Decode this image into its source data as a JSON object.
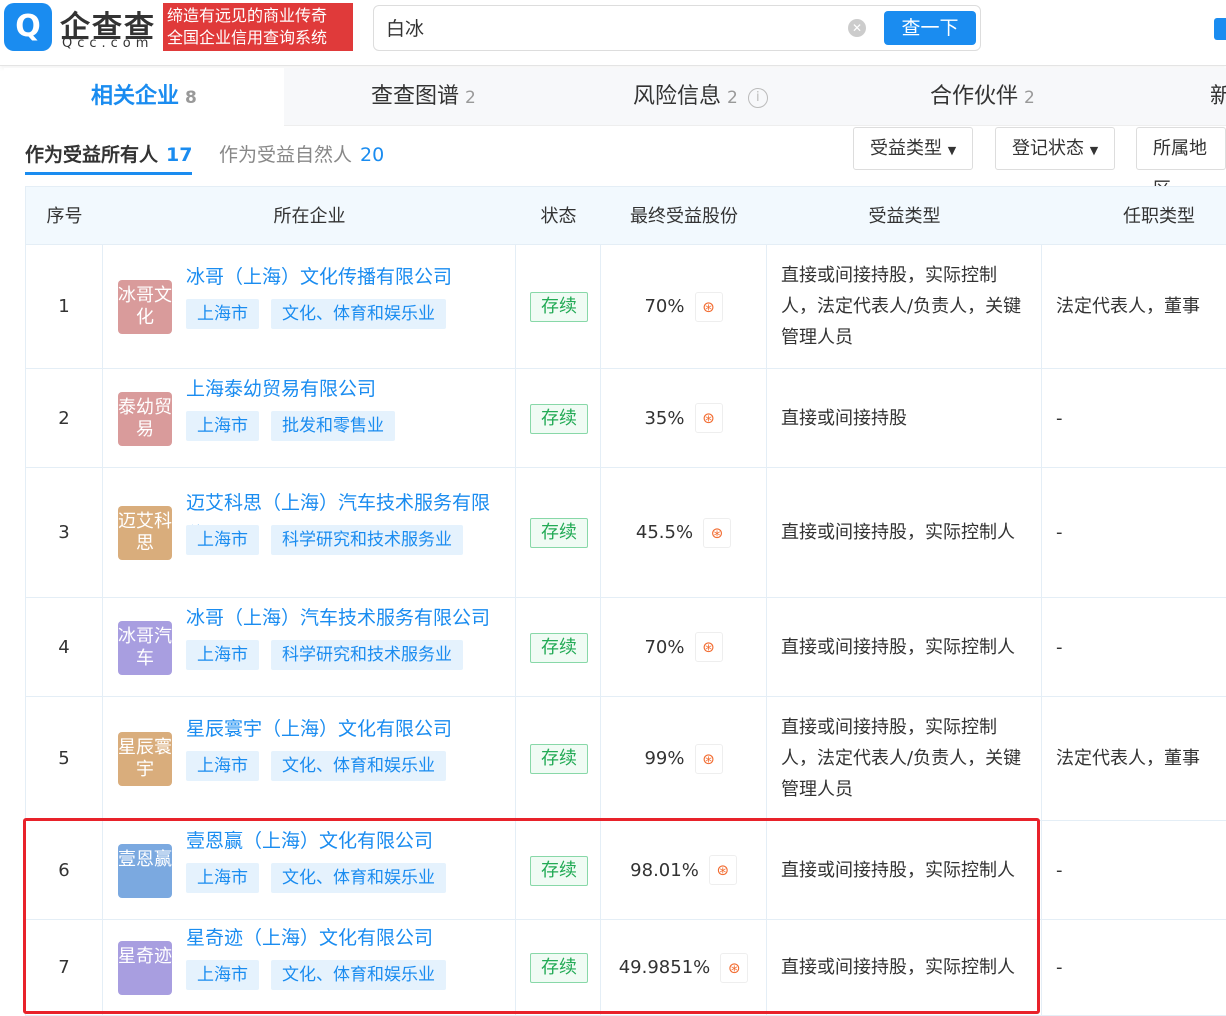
{
  "header": {
    "logo_mark": "Q",
    "logo_text": "企查查",
    "logo_sub": "Qcc.com",
    "slogan_1": "缔造有远见的商业传奇",
    "slogan_2": "全国企业信用查询系统",
    "search_value": "白冰",
    "search_button": "查一下"
  },
  "tabs": [
    {
      "label": "相关企业",
      "count": "8"
    },
    {
      "label": "查查图谱",
      "count": "2"
    },
    {
      "label": "风险信息",
      "count": "2"
    },
    {
      "label": "合作伙伴",
      "count": "2"
    },
    {
      "label": "新"
    }
  ],
  "subtabs": [
    {
      "label": "作为受益所有人",
      "count": "17"
    },
    {
      "label": "作为受益自然人",
      "count": "20"
    }
  ],
  "filters": [
    "受益类型",
    "登记状态",
    "所属地区"
  ],
  "table": {
    "headers": [
      "序号",
      "所在企业",
      "状态",
      "最终受益股份",
      "受益类型",
      "任职类型"
    ],
    "rows": [
      {
        "index": "1",
        "logo": "冰哥文化",
        "logo_color": "#d99b9b",
        "company": "冰哥（上海）文化传播有限公司",
        "tags": [
          "上海市",
          "文化、体育和娱乐业"
        ],
        "status": "存续",
        "share": "70%",
        "benefit": "直接或间接持股，实际控制人，法定代表人/负责人，关键管理人员",
        "role": "法定代表人，董事"
      },
      {
        "index": "2",
        "logo": "泰幼贸易",
        "logo_color": "#d99b9b",
        "company": "上海泰幼贸易有限公司",
        "tags": [
          "上海市",
          "批发和零售业"
        ],
        "status": "存续",
        "share": "35%",
        "benefit": "直接或间接持股",
        "role": "-"
      },
      {
        "index": "3",
        "logo": "迈艾科思",
        "logo_color": "#d9ad7c",
        "company": "迈艾科思（上海）汽车技术服务有限公司",
        "tags": [
          "上海市",
          "科学研究和技术服务业"
        ],
        "status": "存续",
        "share": "45.5%",
        "benefit": "直接或间接持股，实际控制人",
        "role": "-"
      },
      {
        "index": "4",
        "logo": "冰哥汽车",
        "logo_color": "#a89ee0",
        "company": "冰哥（上海）汽车技术服务有限公司",
        "tags": [
          "上海市",
          "科学研究和技术服务业"
        ],
        "status": "存续",
        "share": "70%",
        "benefit": "直接或间接持股，实际控制人",
        "role": "-"
      },
      {
        "index": "5",
        "logo": "星辰寰宇",
        "logo_color": "#d9ad7c",
        "company": "星辰寰宇（上海）文化有限公司",
        "tags": [
          "上海市",
          "文化、体育和娱乐业"
        ],
        "status": "存续",
        "share": "99%",
        "benefit": "直接或间接持股，实际控制人，法定代表人/负责人，关键管理人员",
        "role": "法定代表人，董事"
      },
      {
        "index": "6",
        "logo": "壹恩赢",
        "logo_color": "#7ba9e0",
        "company": "壹恩赢（上海）文化有限公司",
        "tags": [
          "上海市",
          "文化、体育和娱乐业"
        ],
        "status": "存续",
        "share": "98.01%",
        "benefit": "直接或间接持股，实际控制人",
        "role": "-"
      },
      {
        "index": "7",
        "logo": "星奇迹",
        "logo_color": "#a89ee0",
        "company": "星奇迹（上海）文化有限公司",
        "tags": [
          "上海市",
          "文化、体育和娱乐业"
        ],
        "status": "存续",
        "share": "49.9851%",
        "benefit": "直接或间接持股，实际控制人",
        "role": "-"
      }
    ]
  }
}
